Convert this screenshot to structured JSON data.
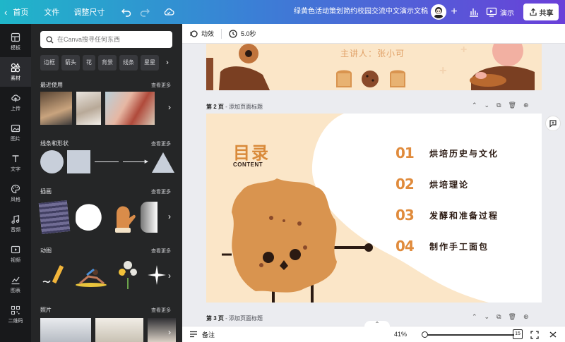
{
  "topbar": {
    "home": "首页",
    "file": "文件",
    "resize": "调整尺寸",
    "doc_title": "绿黄色活动策划简约校园交流中文演示文稿",
    "present": "演示",
    "share": "共享"
  },
  "rail": [
    {
      "label": "模板",
      "icon": "template-icon"
    },
    {
      "label": "素材",
      "icon": "elements-icon"
    },
    {
      "label": "上传",
      "icon": "upload-icon"
    },
    {
      "label": "图片",
      "icon": "photos-icon"
    },
    {
      "label": "文字",
      "icon": "text-icon"
    },
    {
      "label": "风格",
      "icon": "style-icon"
    },
    {
      "label": "音频",
      "icon": "audio-icon"
    },
    {
      "label": "视频",
      "icon": "video-icon"
    },
    {
      "label": "图表",
      "icon": "charts-icon"
    },
    {
      "label": "二维码",
      "icon": "qrcode-icon"
    }
  ],
  "panel": {
    "search_placeholder": "在Canva搜寻任何东西",
    "chips": [
      "边框",
      "箭头",
      "花",
      "背景",
      "线条",
      "星星"
    ],
    "sections": {
      "recent": {
        "title": "最近使用",
        "more": "查看更多"
      },
      "lines": {
        "title": "线条和形状",
        "more": "查看更多"
      },
      "illustrations": {
        "title": "插画",
        "more": "查看更多"
      },
      "animations": {
        "title": "动图",
        "more": "查看更多"
      },
      "photos": {
        "title": "照片",
        "more": "查看更多"
      }
    }
  },
  "toolbar": {
    "animate": "动效",
    "duration": "5.0秒"
  },
  "canvas": {
    "page1_presenter": "主讲人：张小可",
    "page2_label": "第 2 页",
    "page2_add_title": "- 添加页面标题",
    "page3_label": "第 3 页",
    "page3_add_title": "- 添加页面标题",
    "mulu": "目录",
    "content": "CONTENT",
    "toc": [
      {
        "num": "01",
        "text": "烘培历史与文化"
      },
      {
        "num": "02",
        "text": "烘培理论"
      },
      {
        "num": "03",
        "text": "发酵和准备过程"
      },
      {
        "num": "04",
        "text": "制作手工面包"
      }
    ]
  },
  "bottombar": {
    "notes": "备注",
    "zoom": "41%",
    "page_count": "15"
  },
  "colors": {
    "accent_orange": "#e08b3c",
    "slide_bg": "#fbe6c8",
    "cookie": "#d9944f"
  }
}
